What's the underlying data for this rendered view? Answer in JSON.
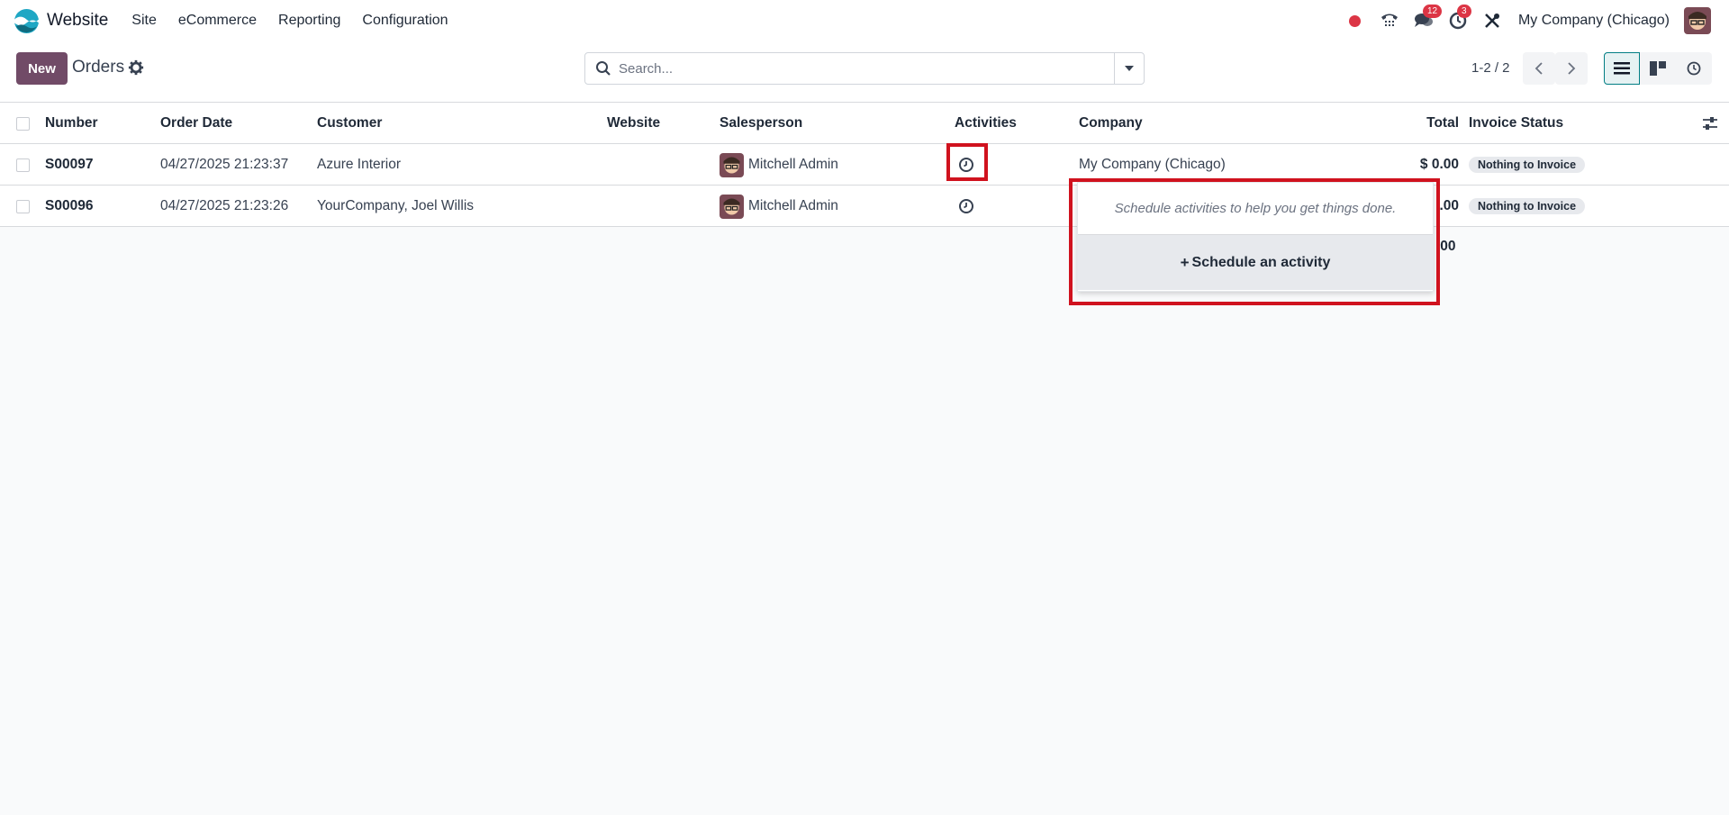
{
  "navbar": {
    "app_name": "Website",
    "menu": [
      "Site",
      "eCommerce",
      "Reporting",
      "Configuration"
    ],
    "messages_badge": "12",
    "activities_badge": "3",
    "company": "My Company (Chicago)",
    "icons": [
      "recording-dot-icon",
      "phone-icon",
      "chat-icon",
      "clock-icon",
      "debug-tools-icon"
    ]
  },
  "control_panel": {
    "new_label": "New",
    "title": "Orders",
    "search_placeholder": "Search...",
    "pager": "1-2 / 2"
  },
  "list": {
    "columns": [
      "Number",
      "Order Date",
      "Customer",
      "Website",
      "Salesperson",
      "Activities",
      "Company",
      "Total",
      "Invoice Status"
    ],
    "rows": [
      {
        "number": "S00097",
        "order_date": "04/27/2025 21:23:37",
        "customer": "Azure Interior",
        "website": "",
        "salesperson": "Mitchell Admin",
        "company": "My Company (Chicago)",
        "total": "$ 0.00",
        "invoice_status": "Nothing to Invoice"
      },
      {
        "number": "S00096",
        "order_date": "04/27/2025 21:23:26",
        "customer": "YourCompany, Joel Willis",
        "website": "",
        "salesperson": "Mitchell Admin",
        "company": "",
        "total": ".00",
        "invoice_status": "Nothing to Invoice"
      }
    ],
    "footer_total": ".00"
  },
  "popover": {
    "empty_text": "Schedule activities to help you get things done.",
    "schedule_label": "Schedule an activity"
  },
  "colors": {
    "brand_primary": "#714b67",
    "active_view": "#017e84",
    "badge": "#dc3545",
    "highlight": "#d0121e"
  }
}
